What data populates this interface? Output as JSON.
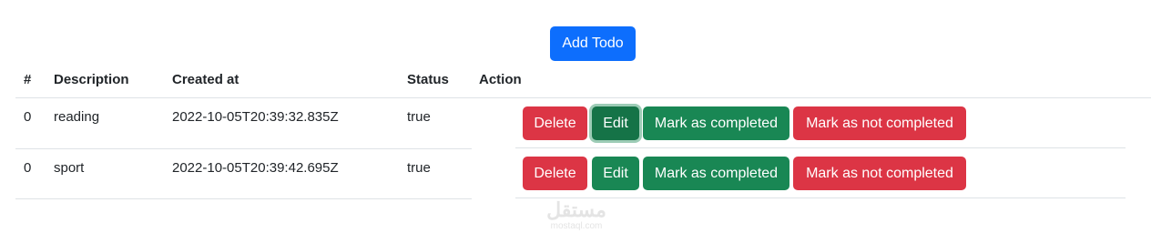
{
  "add_button": "Add Todo",
  "table": {
    "headers": {
      "index": "#",
      "description": "Description",
      "created_at": "Created at",
      "status": "Status",
      "action": "Action"
    },
    "rows": [
      {
        "index": "0",
        "description": "reading",
        "created_at": "2022-10-05T20:39:32.835Z",
        "status": "true"
      },
      {
        "index": "0",
        "description": "sport",
        "created_at": "2022-10-05T20:39:42.695Z",
        "status": "true"
      }
    ]
  },
  "actions": {
    "delete": "Delete",
    "edit": "Edit",
    "mark_completed": "Mark as completed",
    "mark_not_completed": "Mark as not completed"
  },
  "watermark": {
    "logo": "مستقل",
    "site": "mostaql.com"
  },
  "colors": {
    "primary": "#0d6efd",
    "danger": "#dc3545",
    "success": "#198754"
  }
}
